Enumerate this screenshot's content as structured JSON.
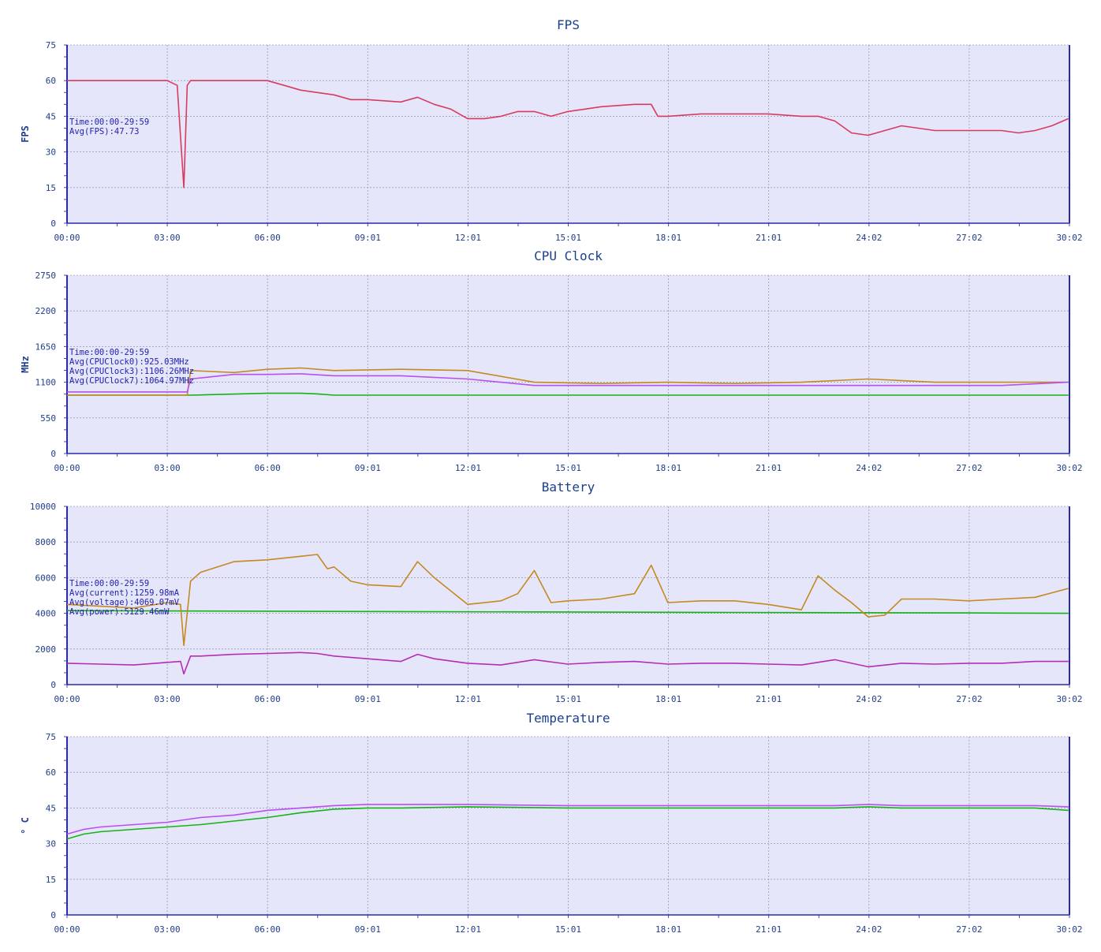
{
  "chart_data": [
    {
      "type": "line",
      "title": "FPS",
      "ylabel": "FPS",
      "xlabel": "",
      "ylim": [
        0,
        75
      ],
      "yticks": [
        0,
        15,
        30,
        45,
        60,
        75
      ],
      "xlim": [
        0,
        30.03
      ],
      "xtick_labels": [
        "00:00",
        "03:00",
        "06:00",
        "09:01",
        "12:01",
        "15:01",
        "18:01",
        "21:01",
        "24:02",
        "27:02",
        "30:02"
      ],
      "grid": true,
      "annotations": [
        "Time:00:00-29:59",
        "Avg(FPS):47.73"
      ],
      "series": [
        {
          "name": "",
          "color": "#d63c5f",
          "x": [
            0,
            1,
            2,
            3,
            3.3,
            3.5,
            3.6,
            3.7,
            4,
            5,
            6,
            6.5,
            7,
            7.5,
            8,
            8.5,
            9,
            10,
            10.5,
            11,
            11.5,
            12,
            12.5,
            13,
            13.5,
            14,
            14.5,
            15,
            15.5,
            16,
            17,
            17.5,
            17.7,
            18,
            19,
            20,
            21,
            22,
            22.5,
            23,
            23.5,
            24,
            24.5,
            25,
            26,
            27,
            28,
            28.5,
            29,
            29.5,
            30
          ],
          "y": [
            60,
            60,
            60,
            60,
            58,
            15,
            58,
            60,
            60,
            60,
            60,
            58,
            56,
            55,
            54,
            52,
            52,
            51,
            53,
            50,
            48,
            44,
            44,
            45,
            47,
            47,
            45,
            47,
            48,
            49,
            50,
            50,
            45,
            45,
            46,
            46,
            46,
            45,
            45,
            43,
            38,
            37,
            39,
            41,
            39,
            39,
            39,
            38,
            39,
            41,
            44
          ]
        }
      ]
    },
    {
      "type": "line",
      "title": "CPU Clock",
      "ylabel": "MHz",
      "xlabel": "",
      "ylim": [
        0,
        2750
      ],
      "yticks": [
        0,
        550,
        1100,
        1650,
        2200,
        2750
      ],
      "xlim": [
        0,
        30.03
      ],
      "xtick_labels": [
        "00:00",
        "03:00",
        "06:00",
        "09:01",
        "12:01",
        "15:01",
        "18:01",
        "21:01",
        "24:02",
        "27:02",
        "30:02"
      ],
      "grid": true,
      "annotations": [
        "Time:00:00-29:59",
        "Avg(CPUClock0):925.03MHz",
        "Avg(CPUClock3):1106.26MHz",
        "Avg(CPUClock7):1064.97MHz"
      ],
      "series": [
        {
          "name": "CPUClock0",
          "color": "#16b216",
          "x": [
            0,
            3.6,
            3.7,
            6,
            7,
            7.5,
            8,
            12,
            20,
            30
          ],
          "y": [
            900,
            900,
            900,
            930,
            930,
            920,
            900,
            900,
            900,
            900
          ]
        },
        {
          "name": "CPUClock3",
          "color": "#c48a20",
          "x": [
            0,
            3.6,
            3.7,
            5,
            6,
            7,
            8,
            10,
            12,
            14,
            16,
            18,
            20,
            22,
            24,
            26,
            28,
            30
          ],
          "y": [
            900,
            900,
            1280,
            1250,
            1300,
            1320,
            1280,
            1300,
            1280,
            1100,
            1080,
            1100,
            1080,
            1100,
            1150,
            1100,
            1100,
            1100
          ]
        },
        {
          "name": "CPUClock7",
          "color": "#b84ff0",
          "x": [
            0,
            3.6,
            3.7,
            5,
            6,
            7,
            8,
            10,
            12,
            14,
            16,
            18,
            20,
            22,
            24,
            26,
            28,
            30
          ],
          "y": [
            950,
            950,
            1150,
            1220,
            1220,
            1230,
            1200,
            1200,
            1150,
            1050,
            1050,
            1050,
            1050,
            1050,
            1050,
            1050,
            1050,
            1100
          ]
        }
      ]
    },
    {
      "type": "line",
      "title": "Battery",
      "ylabel": "",
      "xlabel": "",
      "ylim": [
        0,
        10000
      ],
      "yticks": [
        0,
        2000,
        4000,
        6000,
        8000,
        10000
      ],
      "xlim": [
        0,
        30.03
      ],
      "xtick_labels": [
        "00:00",
        "03:00",
        "06:00",
        "09:01",
        "12:01",
        "15:01",
        "18:01",
        "21:01",
        "24:02",
        "27:02",
        "30:02"
      ],
      "grid": true,
      "annotations": [
        "Time:00:00-29:59",
        "Avg(current):1259.98mA",
        "Avg(voltage):4069.07mV",
        "Avg(power):5129.46mW"
      ],
      "series": [
        {
          "name": "current",
          "color": "#b52db5",
          "x": [
            0,
            1,
            2,
            3,
            3.4,
            3.5,
            3.7,
            4,
            5,
            6,
            7,
            7.5,
            8,
            9,
            10,
            10.5,
            11,
            12,
            13,
            14,
            15,
            16,
            17,
            18,
            19,
            20,
            21,
            22,
            23,
            24,
            25,
            26,
            27,
            28,
            29,
            30
          ],
          "y": [
            1200,
            1150,
            1100,
            1250,
            1300,
            600,
            1600,
            1600,
            1700,
            1750,
            1800,
            1750,
            1600,
            1450,
            1300,
            1700,
            1450,
            1200,
            1100,
            1400,
            1150,
            1250,
            1300,
            1150,
            1200,
            1200,
            1150,
            1100,
            1400,
            1000,
            1200,
            1150,
            1200,
            1200,
            1300,
            1300
          ]
        },
        {
          "name": "voltage",
          "color": "#16b216",
          "x": [
            0,
            9,
            20,
            27,
            30
          ],
          "y": [
            4150,
            4100,
            4050,
            4020,
            4000
          ]
        },
        {
          "name": "power",
          "color": "#c48a20",
          "x": [
            0,
            1,
            2,
            3,
            3.4,
            3.5,
            3.7,
            4,
            5,
            6,
            7,
            7.5,
            7.8,
            8,
            8.5,
            9,
            10,
            10.5,
            11,
            12,
            13,
            13.5,
            14,
            14.5,
            15,
            16,
            17,
            17.5,
            18,
            19,
            20,
            21,
            22,
            22.5,
            23,
            23.5,
            24,
            24.5,
            25,
            26,
            27,
            28,
            29,
            30
          ],
          "y": [
            4500,
            4400,
            4300,
            4600,
            4500,
            2200,
            5800,
            6300,
            6900,
            7000,
            7200,
            7300,
            6500,
            6600,
            5800,
            5600,
            5500,
            6900,
            6000,
            4500,
            4700,
            5100,
            6400,
            4600,
            4700,
            4800,
            5100,
            6700,
            4600,
            4700,
            4700,
            4500,
            4200,
            6100,
            5300,
            4600,
            3800,
            3900,
            4800,
            4800,
            4700,
            4800,
            4900,
            5400
          ]
        }
      ]
    },
    {
      "type": "line",
      "title": "Temperature",
      "ylabel": "° C",
      "xlabel": "",
      "ylim": [
        0,
        75
      ],
      "yticks": [
        0,
        15,
        30,
        45,
        60,
        75
      ],
      "xlim": [
        0,
        30.03
      ],
      "xtick_labels": [
        "00:00",
        "03:00",
        "06:00",
        "09:01",
        "12:01",
        "15:01",
        "18:01",
        "21:01",
        "24:02",
        "27:02",
        "30:02"
      ],
      "grid": true,
      "annotations": [],
      "series": [
        {
          "name": "",
          "color": "#b84ff0",
          "x": [
            0,
            0.5,
            1,
            2,
            3,
            4,
            5,
            6,
            7,
            8,
            9,
            10,
            12,
            15,
            18,
            21,
            23,
            24,
            25,
            27,
            29,
            30
          ],
          "y": [
            34,
            36,
            37,
            38,
            39,
            41,
            42,
            44,
            45,
            46,
            46.5,
            46.5,
            46.5,
            46,
            46,
            46,
            46,
            46.5,
            46,
            46,
            46,
            45.5
          ]
        },
        {
          "name": "",
          "color": "#16b216",
          "x": [
            0,
            0.5,
            1,
            2,
            3,
            4,
            5,
            6,
            7,
            8,
            9,
            10,
            12,
            15,
            18,
            21,
            23,
            24,
            25,
            27,
            29,
            30
          ],
          "y": [
            32,
            34,
            35,
            36,
            37,
            38,
            39.5,
            41,
            43,
            44.5,
            45,
            45,
            45.5,
            45,
            45,
            45,
            45,
            45.5,
            45,
            45,
            45,
            44
          ]
        }
      ]
    }
  ]
}
